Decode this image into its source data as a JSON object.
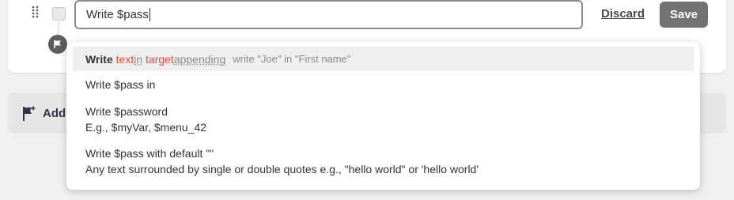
{
  "step": {
    "input_value": "Write $pass",
    "discard_label": "Discard",
    "save_label": "Save"
  },
  "add_bar": {
    "label": "Add"
  },
  "suggestions": {
    "active": {
      "keyword": "Write",
      "arg1": "text",
      "sep1": " in",
      "arg2": "target",
      "sep2": " appending",
      "hint": "write \"Joe\" in \"First name\""
    },
    "items": [
      {
        "title": "Write $pass in",
        "detail": ""
      },
      {
        "title": "Write $password",
        "detail": "E.g., $myVar, $menu_42"
      },
      {
        "title": "Write $pass with default \"\"",
        "detail": "Any text surrounded by single or double quotes e.g., \"hello world\" or 'hello world'"
      }
    ]
  },
  "colors": {
    "token_red": "#e5483a",
    "save_bg": "#727272",
    "flag_bg": "#5d5d5d"
  },
  "icons": {
    "drag": "drag-handle-icon",
    "flag": "flag-icon",
    "add_flag": "flag-plus-icon"
  }
}
